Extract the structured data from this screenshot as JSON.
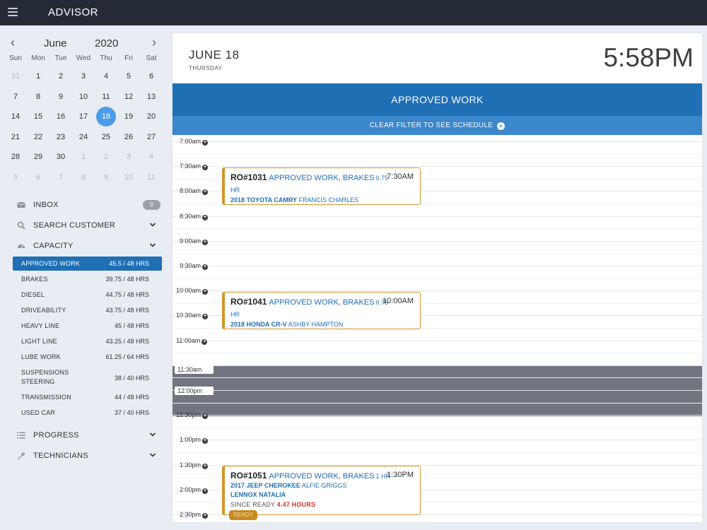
{
  "app": {
    "title": "ADVISOR"
  },
  "calendar": {
    "month": "June",
    "year": "2020",
    "prev_icon": "chevron-left-icon",
    "next_icon": "chevron-right-icon",
    "weekdays": [
      "Sun",
      "Mon",
      "Tue",
      "Wed",
      "Thu",
      "Fri",
      "Sat"
    ],
    "weeks": [
      [
        "31",
        "1",
        "2",
        "3",
        "4",
        "5",
        "6"
      ],
      [
        "7",
        "8",
        "9",
        "10",
        "11",
        "12",
        "13"
      ],
      [
        "14",
        "15",
        "16",
        "17",
        "18",
        "19",
        "20"
      ],
      [
        "21",
        "22",
        "23",
        "24",
        "25",
        "26",
        "27"
      ],
      [
        "28",
        "29",
        "30",
        "1",
        "2",
        "3",
        "4"
      ],
      [
        "5",
        "6",
        "7",
        "8",
        "9",
        "10",
        "11"
      ]
    ],
    "selected": "18",
    "accent": "#4a9be8"
  },
  "nav": {
    "inbox": {
      "label": "INBOX",
      "count": "0",
      "icon": "envelope-icon"
    },
    "search": {
      "label": "SEARCH CUSTOMER",
      "icon": "search-icon"
    },
    "capacity": {
      "label": "CAPACITY",
      "icon": "gauge-icon"
    },
    "progress": {
      "label": "PROGRESS",
      "icon": "list-icon"
    },
    "technicians": {
      "label": "TECHNICIANS",
      "icon": "wrench-icon"
    }
  },
  "capacity": [
    {
      "name": "APPROVED WORK",
      "value": "45.5 / 48 HRS",
      "active": true
    },
    {
      "name": "BRAKES",
      "value": "39.75 / 48 HRS"
    },
    {
      "name": "DIESEL",
      "value": "44.75 / 48 HRS"
    },
    {
      "name": "DRIVEABILITY",
      "value": "43.75 / 48 HRS"
    },
    {
      "name": "HEAVY LINE",
      "value": "45 / 48 HRS"
    },
    {
      "name": "LIGHT LINE",
      "value": "43.25 / 48 HRS"
    },
    {
      "name": "LUBE WORK",
      "value": "61.25 / 64 HRS"
    },
    {
      "name": "SUSPENSIONS STEERING",
      "value": "38 / 40 HRS"
    },
    {
      "name": "TRANSMISSION",
      "value": "44 / 48 HRS"
    },
    {
      "name": "USED CAR",
      "value": "37 / 40 HRS"
    }
  ],
  "header": {
    "date": "JUNE 18",
    "weekday": "THURSDAY",
    "clock": "5:58PM"
  },
  "banner": {
    "title": "APPROVED WORK",
    "filter": "CLEAR FILTER TO SEE SCHEDULE",
    "filter_icon": "close-circle-icon"
  },
  "times": [
    "7:00am",
    "7:30am",
    "8:00am",
    "8:30am",
    "9:00am",
    "9:30am",
    "10:00am",
    "10:30am",
    "11:00am",
    "11:30am",
    "12:00pm",
    "12:30pm",
    "1:00pm",
    "1:30pm",
    "2:00pm",
    "2:30pm"
  ],
  "appointments": [
    {
      "ro": "RO#1031",
      "type": "APPROVED WORK, BRAKES",
      "hours": "0.75",
      "hours2": "HR",
      "time": "7:30AM",
      "vehicle": "2018 TOYOTA CAMRY",
      "customer": "FRANCIS CHARLES"
    },
    {
      "ro": "RO#1041",
      "type": "APPROVED WORK, BRAKES",
      "hours": "0.75",
      "hours2": "HR",
      "time": "10:00AM",
      "vehicle": "2018 HONDA CR-V",
      "customer": "ASHBY HAMPTON"
    },
    {
      "ro": "RO#1051",
      "type": "APPROVED WORK, BRAKES",
      "hours": "1 HR",
      "time": "1:30PM",
      "vehicle": "2017 JEEP CHEROKEE",
      "customer": "ALFIE GRIGGS",
      "technician": "LENNOX NATALIA",
      "since_label": "SINCE READY",
      "since_value": "4.47 HOURS",
      "badge": "READY"
    }
  ],
  "colors": {
    "topbar": "#252b36",
    "primary": "#1f6fb5",
    "filter": "#3a87cc",
    "appt_border": "#d4962a",
    "alert": "#d9342b"
  }
}
